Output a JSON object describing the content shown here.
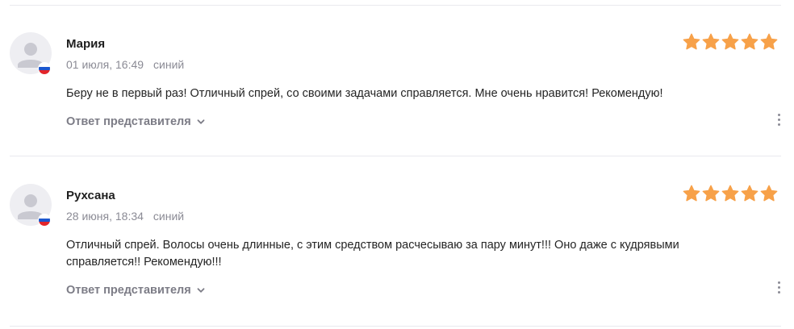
{
  "colors": {
    "star": "#f7a149",
    "meta_text": "#8b8b95",
    "reply_text": "#7c7c86",
    "divider": "#e9e9ee"
  },
  "reviews": [
    {
      "author": "Мария",
      "date": "01 июля, 16:49",
      "variant": "синий",
      "rating": 5,
      "text": "Беру не в первый раз! Отличный спрей, со своими задачами справляется. Мне очень нравится! Рекомендую!",
      "reply_label": "Ответ представителя",
      "country_flag": "russia-flag-icon"
    },
    {
      "author": "Рухсана",
      "date": "28 июня, 18:34",
      "variant": "синий",
      "rating": 5,
      "text": "Отличный спрей. Волосы очень длинные, с этим средством расчесываю за пару минут!!! Оно даже с кудрявыми справляется!! Рекомендую!!!",
      "reply_label": "Ответ представителя",
      "country_flag": "russia-flag-icon"
    }
  ]
}
